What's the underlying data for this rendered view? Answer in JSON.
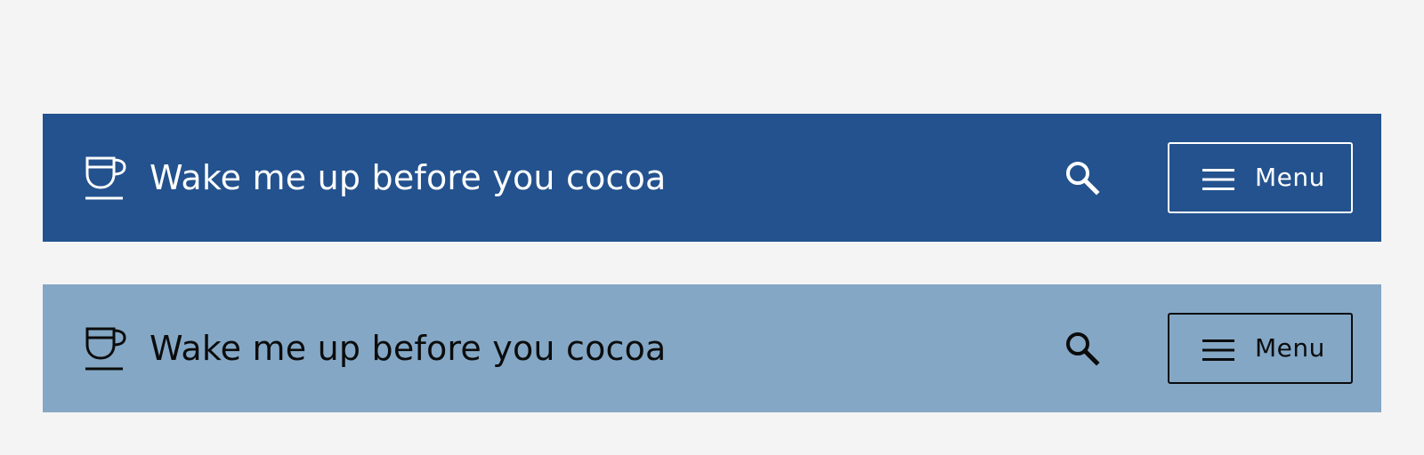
{
  "headers": [
    {
      "variant": "dark",
      "background": "#23528e",
      "foreground": "#ffffff",
      "logo_icon": "cup-icon",
      "title": "Wake me up before you cocoa",
      "search_icon": "search-icon",
      "menu_icon": "hamburger-icon",
      "menu_label": "Menu"
    },
    {
      "variant": "light",
      "background": "#84a7c5",
      "foreground": "#0b0c0c",
      "logo_icon": "cup-icon",
      "title": "Wake me up before you cocoa",
      "search_icon": "search-icon",
      "menu_icon": "hamburger-icon",
      "menu_label": "Menu"
    }
  ]
}
